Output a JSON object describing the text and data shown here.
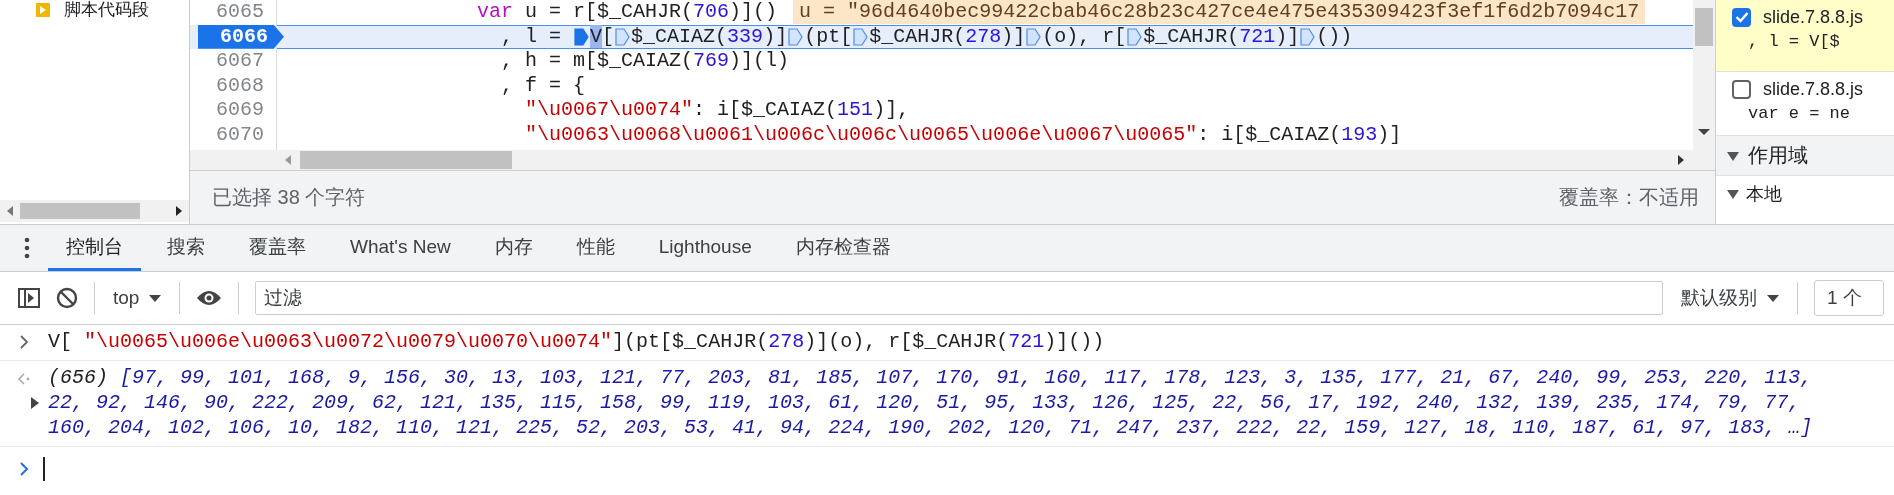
{
  "sidebar": {
    "items": [
      {
        "label": "脚本代码段"
      }
    ]
  },
  "editor": {
    "lines": [
      {
        "number": "6065",
        "current": false,
        "parts": [
          {
            "kind": "text",
            "tokens": [
              {
                "kind": "keyword",
                "text": "                var"
              },
              {
                "kind": "plain",
                "text": " u = r[$_CAHJR("
              },
              {
                "kind": "number",
                "text": "706"
              },
              {
                "kind": "plain",
                "text": ")]()"
              }
            ]
          },
          {
            "kind": "value",
            "text": "u = \"96d4640bec99422cbab46c28b23c427ce4e475e435309423f3ef1f6d2b7094c17"
          }
        ]
      },
      {
        "number": "6066",
        "current": true,
        "parts": [
          {
            "kind": "text",
            "tokens": [
              {
                "kind": "plain",
                "text": "                  , l = "
              }
            ]
          },
          {
            "kind": "marker",
            "active": true
          },
          {
            "kind": "text",
            "tokens": [
              {
                "kind": "selection",
                "text": "V"
              },
              {
                "kind": "plain",
                "text": "["
              }
            ]
          },
          {
            "kind": "marker",
            "active": false
          },
          {
            "kind": "text",
            "tokens": [
              {
                "kind": "plain",
                "text": "$_CAIAZ("
              },
              {
                "kind": "number",
                "text": "339"
              },
              {
                "kind": "plain",
                "text": ")]"
              }
            ]
          },
          {
            "kind": "marker",
            "active": false
          },
          {
            "kind": "text",
            "tokens": [
              {
                "kind": "plain",
                "text": "(pt["
              }
            ]
          },
          {
            "kind": "marker",
            "active": false
          },
          {
            "kind": "text",
            "tokens": [
              {
                "kind": "plain",
                "text": "$_CAHJR("
              },
              {
                "kind": "number",
                "text": "278"
              },
              {
                "kind": "plain",
                "text": ")]"
              }
            ]
          },
          {
            "kind": "marker",
            "active": false
          },
          {
            "kind": "text",
            "tokens": [
              {
                "kind": "plain",
                "text": "(o), r["
              }
            ]
          },
          {
            "kind": "marker",
            "active": false
          },
          {
            "kind": "text",
            "tokens": [
              {
                "kind": "plain",
                "text": "$_CAHJR("
              },
              {
                "kind": "number",
                "text": "721"
              },
              {
                "kind": "plain",
                "text": ")]"
              }
            ]
          },
          {
            "kind": "marker",
            "active": false
          },
          {
            "kind": "text",
            "tokens": [
              {
                "kind": "plain",
                "text": "())"
              }
            ]
          }
        ]
      },
      {
        "number": "6067",
        "current": false,
        "parts": [
          {
            "kind": "text",
            "tokens": [
              {
                "kind": "plain",
                "text": "                  , h = m[$_CAIAZ("
              },
              {
                "kind": "number",
                "text": "769"
              },
              {
                "kind": "plain",
                "text": ")](l)"
              }
            ]
          }
        ]
      },
      {
        "number": "6068",
        "current": false,
        "parts": [
          {
            "kind": "text",
            "tokens": [
              {
                "kind": "plain",
                "text": "                  , f = {"
              }
            ]
          }
        ]
      },
      {
        "number": "6069",
        "current": false,
        "parts": [
          {
            "kind": "text",
            "tokens": [
              {
                "kind": "string",
                "text": "                    \"\\u0067\\u0074\""
              },
              {
                "kind": "plain",
                "text": ": i[$_CAIAZ("
              },
              {
                "kind": "number",
                "text": "151"
              },
              {
                "kind": "plain",
                "text": ")],"
              }
            ]
          }
        ]
      },
      {
        "number": "6070",
        "current": false,
        "parts": [
          {
            "kind": "text",
            "tokens": [
              {
                "kind": "string",
                "text": "                    \"\\u0063\\u0068\\u0061\\u006c\\u006c\\u0065\\u006e\\u0067\\u0065\""
              },
              {
                "kind": "plain",
                "text": ": i[$_CAIAZ("
              },
              {
                "kind": "number",
                "text": "193"
              },
              {
                "kind": "plain",
                "text": ")]"
              }
            ]
          }
        ]
      }
    ]
  },
  "status_bar": {
    "selection": "已选择 38 个字符",
    "coverage": "覆盖率：不适用"
  },
  "breakpoints": [
    {
      "file": "slide.7.8.8.js",
      "code": ", l = V[$",
      "checked": true,
      "paused": true
    },
    {
      "file": "slide.7.8.8.js",
      "code": "var e = ne",
      "checked": false,
      "paused": false
    }
  ],
  "scope": {
    "title": "作用域",
    "expanded": true,
    "sections": [
      {
        "label": "本地",
        "expanded": true
      }
    ]
  },
  "drawer_tabs": [
    {
      "label": "控制台",
      "selected": true
    },
    {
      "label": "搜索",
      "selected": false
    },
    {
      "label": "覆盖率",
      "selected": false
    },
    {
      "label": "What's New",
      "selected": false
    },
    {
      "label": "内存",
      "selected": false
    },
    {
      "label": "性能",
      "selected": false
    },
    {
      "label": "Lighthouse",
      "selected": false
    },
    {
      "label": "内存检查器",
      "selected": false
    }
  ],
  "console_toolbar": {
    "context": "top",
    "filter_placeholder": "过滤",
    "level": "默认级别",
    "issues": "1 个"
  },
  "console": {
    "entries": [
      {
        "kind": "input",
        "lines": [
          [
            {
              "kind": "plain",
              "text": "V[ "
            },
            {
              "kind": "string",
              "text": "\"\\u0065\\u006e\\u0063\\u0072\\u0079\\u0070\\u0074\""
            },
            {
              "kind": "plain",
              "text": "](pt[$_CAHJR("
            },
            {
              "kind": "number",
              "text": "278"
            },
            {
              "kind": "plain",
              "text": ")](o), r[$_CAHJR("
            },
            {
              "kind": "number",
              "text": "721"
            },
            {
              "kind": "plain",
              "text": ")]())"
            }
          ]
        ]
      },
      {
        "kind": "result",
        "expanded": false,
        "lines": [
          [
            {
              "kind": "meta",
              "text": "(656) "
            },
            {
              "kind": "value",
              "text": "[97, 99, 101, 168, 9, 156, 30, 13, 103, 121, 77, 203, 81, 185, 107, 170, 91, 160, 117, 178, 123, 3, 135, 177, 21, 67, 240, 99, 253, 220, 113,"
            }
          ],
          [
            {
              "kind": "value",
              "text": "22, 92, 146, 90, 222, 209, 62, 121, 135, 115, 158, 99, 119, 103, 61, 120, 51, 95, 133, 126, 125, 22, 56, 17, 192, 240, 132, 139, 235, 174, 79, 77,"
            }
          ],
          [
            {
              "kind": "value",
              "text": "160, 204, 102, 106, 10, 182, 110, 121, 225, 52, 203, 53, 41, 94, 224, 190, 202, 120, 71, 247, 237, 222, 22, 159, 127, 18, 110, 187, 61, 97, 183, …]"
            }
          ]
        ]
      }
    ]
  }
}
